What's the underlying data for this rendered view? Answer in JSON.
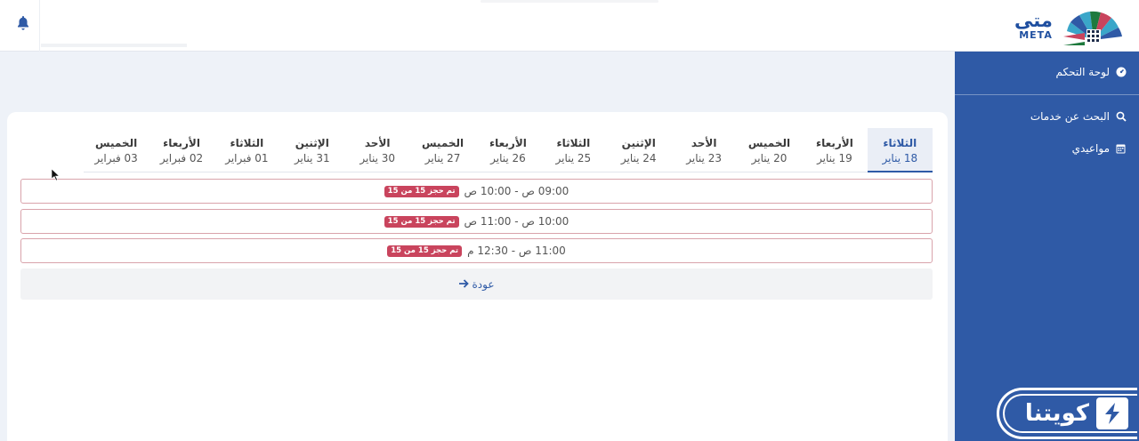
{
  "header": {
    "logo_ar": "متى",
    "logo_en": "META",
    "bell_icon": "bell-icon"
  },
  "sidebar": {
    "items": [
      {
        "label": "لوحة التحكم",
        "icon": "dashboard-icon"
      },
      {
        "label": "البحث عن خدمات",
        "icon": "search-icon"
      },
      {
        "label": "مواعيدي",
        "icon": "calendar-icon"
      }
    ]
  },
  "tabs": [
    {
      "day": "الثلاثاء",
      "date": "18 يناير",
      "active": true
    },
    {
      "day": "الأربعاء",
      "date": "19 يناير"
    },
    {
      "day": "الخميس",
      "date": "20 يناير"
    },
    {
      "day": "الأحد",
      "date": "23 يناير"
    },
    {
      "day": "الإثنين",
      "date": "24 يناير"
    },
    {
      "day": "الثلاثاء",
      "date": "25 يناير"
    },
    {
      "day": "الأربعاء",
      "date": "26 يناير"
    },
    {
      "day": "الخميس",
      "date": "27 يناير"
    },
    {
      "day": "الأحد",
      "date": "30 يناير"
    },
    {
      "day": "الإثنين",
      "date": "31 يناير"
    },
    {
      "day": "الثلاثاء",
      "date": "01 فبراير"
    },
    {
      "day": "الأربعاء",
      "date": "02 فبراير"
    },
    {
      "day": "الخميس",
      "date": "03 فبراير"
    }
  ],
  "slots": [
    {
      "time": "09:00 ص - 10:00 ص",
      "status": "تم حجز 15 من 15"
    },
    {
      "time": "10:00 ص - 11:00 ص",
      "status": "تم حجز 15 من 15"
    },
    {
      "time": "11:00 ص - 12:30 م",
      "status": "تم حجز 15 من 15"
    }
  ],
  "back_label": "عودة",
  "badge": {
    "text": "كويتنا"
  },
  "colors": {
    "primary": "#2f5aa6",
    "booked": "#c9445d"
  }
}
